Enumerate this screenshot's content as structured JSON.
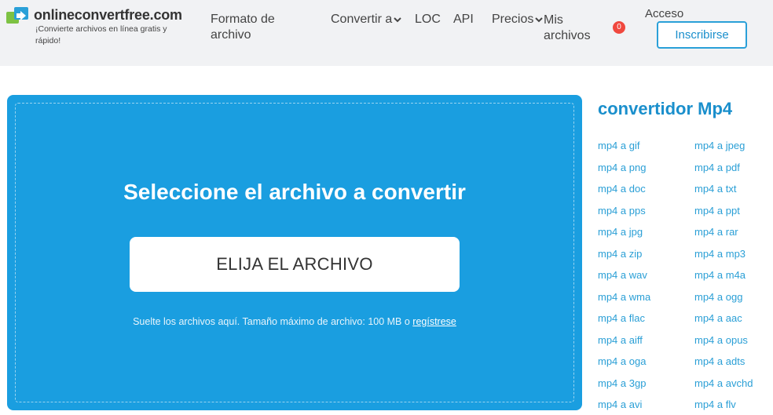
{
  "brand": {
    "name": "onlineconvertfree.com",
    "tagline": "¡Convierte archivos en línea gratis y rápido!"
  },
  "nav": {
    "formato": "Formato de archivo",
    "convertir": "Convertir a",
    "loc": "LOC",
    "api": "API",
    "precios": "Precios",
    "mis_archivos": "Mis archivos",
    "mis_archivos_count": "0",
    "acceso": "Acceso",
    "inscribirse": "Inscribirse"
  },
  "upload": {
    "title": "Seleccione el archivo a convertir",
    "button": "ELIJA EL ARCHIVO",
    "note": "Suelte los archivos aquí. Tamaño máximo de archivo: 100 MB o ",
    "register_link": "regístrese"
  },
  "sidebar": {
    "title": "convertidor Mp4",
    "col1": [
      "mp4 a gif",
      "mp4 a png",
      "mp4 a doc",
      "mp4 a pps",
      "mp4 a jpg",
      "mp4 a zip",
      "mp4 a wav",
      "mp4 a wma",
      "mp4 a flac",
      "mp4 a aiff",
      "mp4 a oga",
      "mp4 a 3gp",
      "mp4 a avi"
    ],
    "col2": [
      "mp4 a jpeg",
      "mp4 a pdf",
      "mp4 a txt",
      "mp4 a ppt",
      "mp4 a rar",
      "mp4 a mp3",
      "mp4 a m4a",
      "mp4 a ogg",
      "mp4 a aac",
      "mp4 a opus",
      "mp4 a adts",
      "mp4 a avchd",
      "mp4 a flv"
    ]
  },
  "colors": {
    "accent": "#1a9ee0",
    "link": "#2a9fd6",
    "badge": "#f0483e",
    "header_bg": "#f1f2f4"
  }
}
